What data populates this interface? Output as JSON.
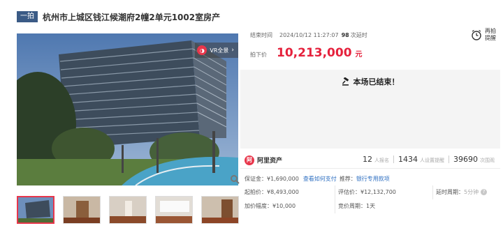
{
  "header": {
    "round_badge": "一拍",
    "title": "杭州市上城区钱江候潮府2幢2单元1002室房产"
  },
  "gallery": {
    "vr_label": "VR全景",
    "vr_logo": "◑",
    "thumbnails": [
      "thumb-1",
      "thumb-2",
      "thumb-3",
      "thumb-4",
      "thumb-5"
    ],
    "active_index": 0
  },
  "auction": {
    "end_time_label": "结束时间",
    "end_time": "2024/10/12 11:27:07",
    "delay_count": "98",
    "delay_label": "次延时",
    "remind_line1": "再拍",
    "remind_line2": "提醒",
    "price_label": "拍下价",
    "price": "10,213,000",
    "price_unit": "元",
    "ended_text": "本场已结束！"
  },
  "stats": {
    "brand": "阿里资产",
    "brand_logo": "阿",
    "signups": "12",
    "signups_label": "人报名",
    "reminders": "1434",
    "reminders_label": "人设置提醒",
    "views": "39690",
    "views_label": "次围观"
  },
  "details": {
    "deposit_label": "保证金：",
    "deposit": "¥1,690,000",
    "how_to_pay": "查看如何支付",
    "recommend_label": "推荐：",
    "recommend_link": "银行专用款项",
    "start_price_label": "起拍价：",
    "start_price": "¥8,493,000",
    "appraisal_label": "评估价：",
    "appraisal": "¥12,132,700",
    "delay_period_label": "延时周期：",
    "delay_period": "5分钟",
    "increment_label": "加价幅度：",
    "increment": "¥10,000",
    "bid_period_label": "竞价周期：",
    "bid_period": "1天"
  },
  "colors": {
    "accent_red": "#e5213c",
    "badge_blue": "#3b5b86",
    "link_blue": "#2e6fc1"
  }
}
